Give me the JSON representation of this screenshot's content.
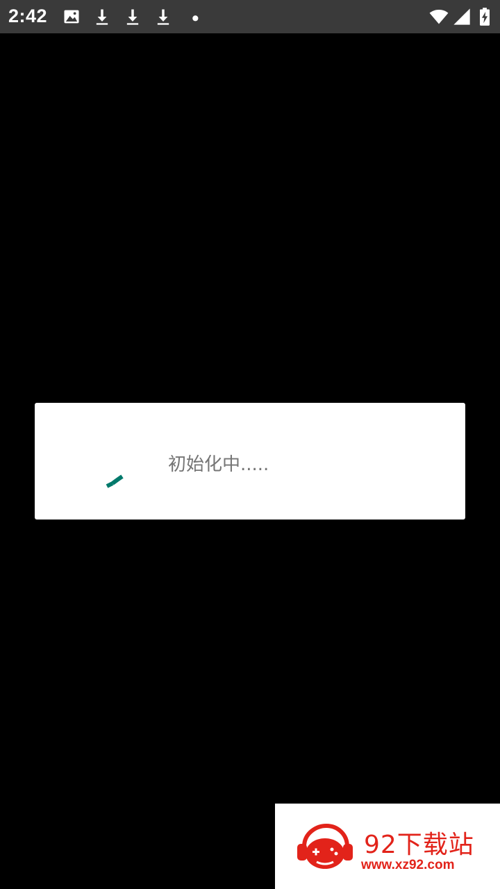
{
  "status_bar": {
    "time": "2:42",
    "left_icons": [
      "image-icon",
      "download-icon",
      "download-icon",
      "download-icon",
      "dot-icon"
    ],
    "right_icons": [
      "wifi-icon",
      "signal-icon",
      "battery-charging-icon"
    ],
    "background": "#3a3a3a"
  },
  "dialog": {
    "message": "初始化中.....",
    "spinner_color": "#00796b"
  },
  "watermark": {
    "title": "92下载站",
    "url": "www.xz92.com",
    "brand_color": "#e2231a"
  }
}
